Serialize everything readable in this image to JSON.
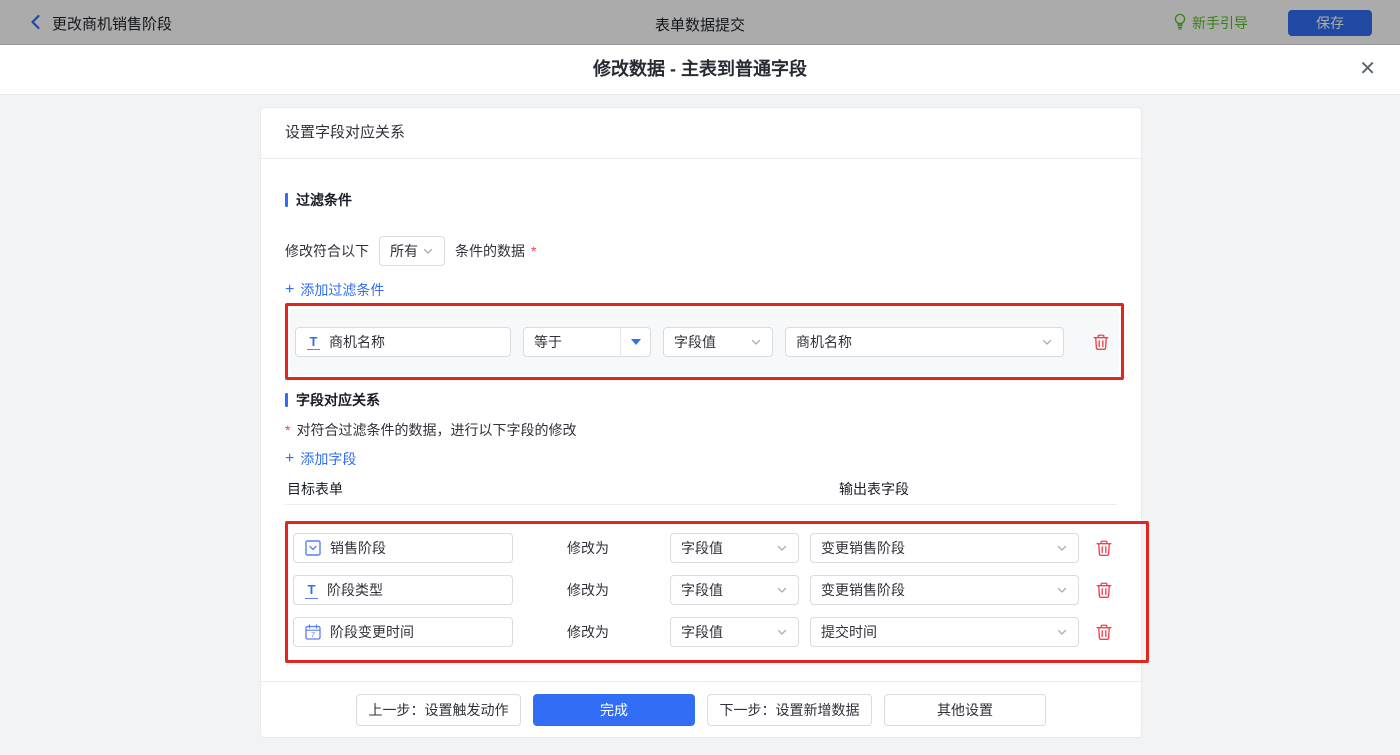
{
  "colors": {
    "primary": "#316EF5",
    "annotation_red": "#E2261F",
    "danger": "#F0424E",
    "guide_green": "#52C41A"
  },
  "icons": {
    "plus": "+",
    "close": "✕"
  },
  "topbar": {
    "back_label": "更改商机销售阶段",
    "center_title": "表单数据提交",
    "guide_label": "新手引导",
    "save_label": "保存"
  },
  "dialog": {
    "title": "修改数据 - 主表到普通字段"
  },
  "card": {
    "header": "设置字段对应关系",
    "filter_section": {
      "title": "过滤条件",
      "condition_prefix": "修改符合以下",
      "condition_select": "所有",
      "condition_suffix": "条件的数据",
      "required_mark": "*",
      "add_link": "添加过滤条件",
      "row": {
        "field": "商机名称",
        "field_icon": "text-field-icon",
        "operator": "等于",
        "value_type": "字段值",
        "value": "商机名称"
      }
    },
    "mapping_section": {
      "title": "字段对应关系",
      "required_mark": "*",
      "hint": "对符合过滤条件的数据，进行以下字段的修改",
      "add_link": "添加字段",
      "col_target": "目标表单",
      "col_output": "输出表字段",
      "rows": [
        {
          "field": "销售阶段",
          "field_icon": "select-field-icon",
          "modify_label": "修改为",
          "value_type": "字段值",
          "value": "变更销售阶段"
        },
        {
          "field": "阶段类型",
          "field_icon": "text-field-icon",
          "modify_label": "修改为",
          "value_type": "字段值",
          "value": "变更销售阶段"
        },
        {
          "field": "阶段变更时间",
          "field_icon": "date-field-icon",
          "modify_label": "修改为",
          "value_type": "字段值",
          "value": "提交时间"
        }
      ]
    },
    "footer": {
      "prev_label": "上一步：设置触发动作",
      "done_label": "完成",
      "next_label": "下一步：设置新增数据",
      "other_label": "其他设置"
    }
  }
}
